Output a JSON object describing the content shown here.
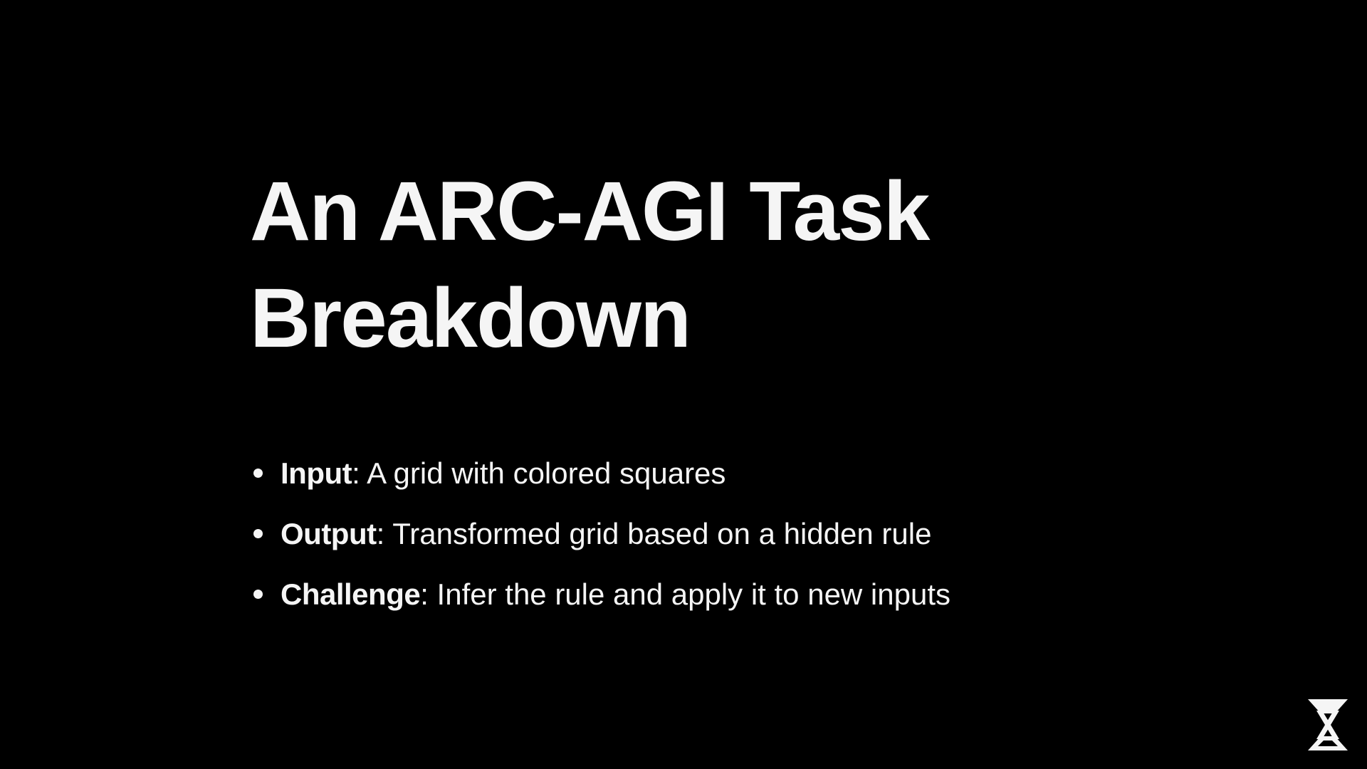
{
  "slide": {
    "title_lines": [
      "An ARC-AGI Task",
      "Breakdown"
    ],
    "bullets": [
      {
        "key": "Input",
        "sep": ":",
        "text": " A grid with colored squares"
      },
      {
        "key": "Output",
        "sep": ":",
        "text": " Transformed grid based on a hidden rule"
      },
      {
        "key": "Challenge",
        "sep": ":",
        "text": " Infer the rule and apply it to new inputs"
      }
    ],
    "logo_icon": "hourglass-x-logo-icon"
  },
  "colors": {
    "background": "#000000",
    "text": "#f5f5f5"
  }
}
